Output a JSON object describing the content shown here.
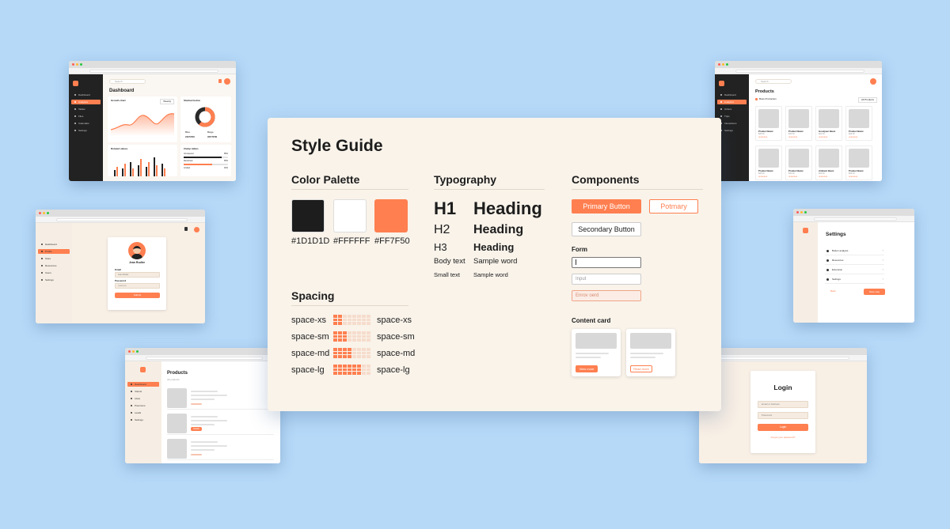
{
  "colors": {
    "accent": "#FF7F50",
    "dark": "#1D1D1D",
    "white": "#FFFFFF",
    "cream": "#F9F3EA",
    "backdrop": "#B6D9F8"
  },
  "style_guide": {
    "title": "Style Guide",
    "color_palette": {
      "heading": "Color Palette",
      "swatches": [
        {
          "hex": "#1D1D1D",
          "label": "#1D1D1D"
        },
        {
          "hex": "#FFFFFF",
          "label": "#FFFFFF"
        },
        {
          "hex": "#FF7F50",
          "label": "#FF7F50"
        }
      ]
    },
    "typography": {
      "heading": "Typography",
      "rows": [
        {
          "tag": "H1",
          "sample": "Heading"
        },
        {
          "tag": "H2",
          "sample": "Heading"
        },
        {
          "tag": "H3",
          "sample": "Heading"
        },
        {
          "tag": "Body text",
          "sample": "Sample word"
        },
        {
          "tag": "Small text",
          "sample": "Sample word"
        }
      ]
    },
    "components": {
      "heading": "Components",
      "primary_button": "Primary Button",
      "outline_button": "Potmary",
      "secondary_button": "Secondary Button",
      "form_label": "Form",
      "input_placeholder": "Input",
      "error_placeholder": "Enrov oerd",
      "content_card_label": "Content card",
      "card_buttons": [
        "View more",
        "Read more"
      ]
    },
    "spacing": {
      "heading": "Spacing",
      "rows": [
        {
          "label": "space-xs",
          "filled": 2
        },
        {
          "label": "space-sm",
          "filled": 3
        },
        {
          "label": "space-md",
          "filled": 4
        },
        {
          "label": "space-lg",
          "filled": 6
        }
      ]
    }
  },
  "dashboard_window": {
    "search_placeholder": "Search",
    "title": "Dashboard",
    "nav": [
      "Dashboard",
      "Analytics",
      "Tables",
      "Files",
      "Calendars",
      "Settings"
    ],
    "active_nav": 1,
    "growth_chart_title": "Growth chart",
    "chart_dropdown": "Weekly",
    "donut_title": "Stacked below",
    "donut_legend": [
      "Blue",
      "Beige"
    ],
    "donut_values": [
      "#1F5700",
      "#FF7F50"
    ],
    "bar_chart_title": "Rotated values",
    "progress_title": "Clamp tables",
    "progress_items": [
      {
        "label": "Unmetered",
        "value": "85%"
      },
      {
        "label": "Restricted",
        "value": "65%"
      },
      {
        "label": "Limited",
        "value": "40%"
      }
    ]
  },
  "products_grid_window": {
    "search_placeholder": "Search",
    "title": "Products",
    "filter_label": "Boss Production",
    "filter_dropdown": "All Products",
    "nav": [
      "Dashboard",
      "Analytics",
      "Orders",
      "Trips",
      "Interactions",
      "Settings"
    ],
    "active_nav": 1,
    "products": [
      {
        "name": "Product Basic",
        "price": "$28.00"
      },
      {
        "name": "Product Basic",
        "price": "$32.00"
      },
      {
        "name": "Goodyear Basic",
        "price": "$24.00"
      },
      {
        "name": "Product Basic",
        "price": "$29.00"
      },
      {
        "name": "Product Basic",
        "price": "$28.00"
      },
      {
        "name": "Product Basic",
        "price": "$32.00"
      },
      {
        "name": "Ambient Basic",
        "price": "$24.00"
      },
      {
        "name": "Product Basic",
        "price": "$29.00"
      }
    ]
  },
  "profile_window": {
    "nav": [
      "Dashboard",
      "Profile",
      "Store",
      "Resources",
      "Users",
      "Settings"
    ],
    "active_nav": 1,
    "name": "Jean Rudier",
    "email_label": "Email",
    "email_value": "Jean Rudier",
    "password_label": "Password",
    "password_value": "••••••••••••",
    "submit": "Submit"
  },
  "settings_window": {
    "title": "Settings",
    "rows": [
      "Button analysis",
      "Resources",
      "Extension",
      "Settings"
    ],
    "cancel": "Back",
    "save": "Save way"
  },
  "products_list_window": {
    "title": "Products",
    "subtitle": "All products",
    "nav": [
      "Dashboard",
      "Clients",
      "Likes",
      "Premiums",
      "Leads",
      "Settings"
    ],
    "active_nav": 0,
    "item_button": "Details"
  },
  "login_window": {
    "title": "Login",
    "email_placeholder": "Email or Address",
    "password_placeholder": "Password",
    "submit": "Login",
    "forgot": "Forgot your password?"
  }
}
